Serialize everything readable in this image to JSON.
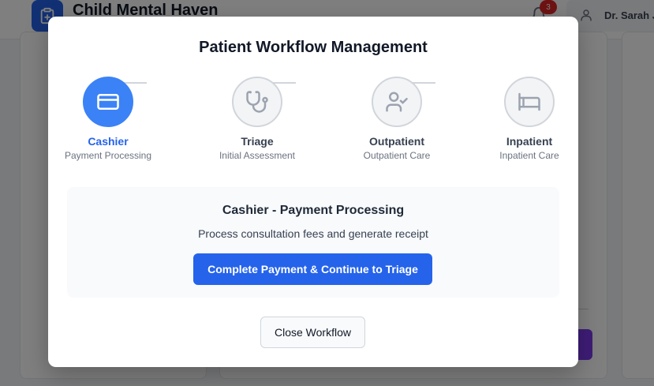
{
  "app": {
    "title": "Child Mental Haven",
    "notification_count": "3",
    "user_name": "Dr. Sarah J"
  },
  "modal": {
    "title": "Patient Workflow Management",
    "steps": [
      {
        "name": "Cashier",
        "sub": "Payment Processing",
        "icon": "credit-card-icon",
        "active": true
      },
      {
        "name": "Triage",
        "sub": "Initial Assessment",
        "icon": "stethoscope-icon",
        "active": false
      },
      {
        "name": "Outpatient",
        "sub": "Outpatient Care",
        "icon": "user-check-icon",
        "active": false
      },
      {
        "name": "Inpatient",
        "sub": "Inpatient Care",
        "icon": "bed-icon",
        "active": false
      }
    ],
    "panel": {
      "title": "Cashier - Payment Processing",
      "description": "Process consultation fees and generate receipt",
      "action_label": "Complete Payment & Continue to Triage"
    },
    "close_label": "Close Workflow"
  },
  "colors": {
    "accent": "#3b82f6",
    "primary_button": "#2563eb",
    "inactive_step": "#f3f4f6",
    "badge": "#dc2626"
  }
}
